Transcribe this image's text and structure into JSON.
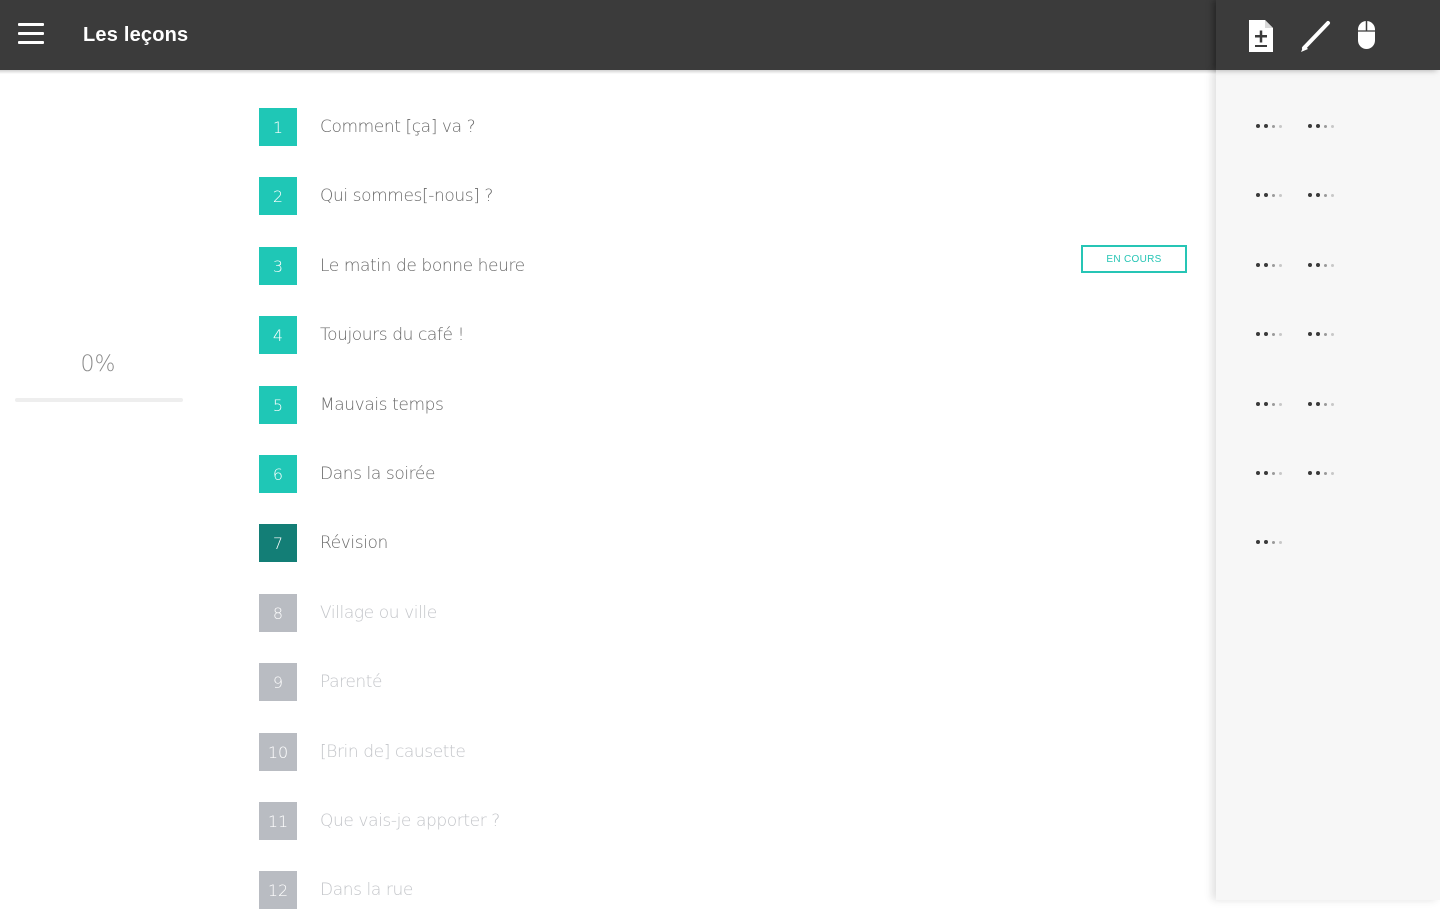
{
  "header": {
    "title": "Les leçons",
    "icons": [
      "document-icon",
      "pencil-icon",
      "mouse-icon"
    ]
  },
  "progress": {
    "percent_label": "0%",
    "value": 0
  },
  "colors": {
    "accent": "#1fc7b6",
    "accent_dark": "#137e76",
    "locked": "#b9bcc2",
    "header_bg": "#3b3b3b"
  },
  "lessons": [
    {
      "number": "1",
      "title": "Comment [ça] va ?",
      "state": "active"
    },
    {
      "number": "2",
      "title": "Qui sommes[-nous] ?",
      "state": "active"
    },
    {
      "number": "3",
      "title": "Le matin de bonne heure",
      "state": "active",
      "badge": "EN COURS"
    },
    {
      "number": "4",
      "title": "Toujours du café !",
      "state": "active"
    },
    {
      "number": "5",
      "title": "Mauvais temps",
      "state": "active"
    },
    {
      "number": "6",
      "title": "Dans la soirée",
      "state": "active"
    },
    {
      "number": "7",
      "title": "Révision",
      "state": "dark"
    },
    {
      "number": "8",
      "title": "Village ou ville",
      "state": "locked"
    },
    {
      "number": "9",
      "title": "Parenté",
      "state": "locked"
    },
    {
      "number": "10",
      "title": "[Brin de] causette",
      "state": "locked"
    },
    {
      "number": "11",
      "title": "Que vais-je apporter ?",
      "state": "locked"
    },
    {
      "number": "12",
      "title": "Dans la rue",
      "state": "locked"
    }
  ],
  "lesson_status_columns": [
    2,
    2,
    2,
    2,
    2,
    2,
    1,
    0,
    0,
    0,
    0,
    0
  ]
}
